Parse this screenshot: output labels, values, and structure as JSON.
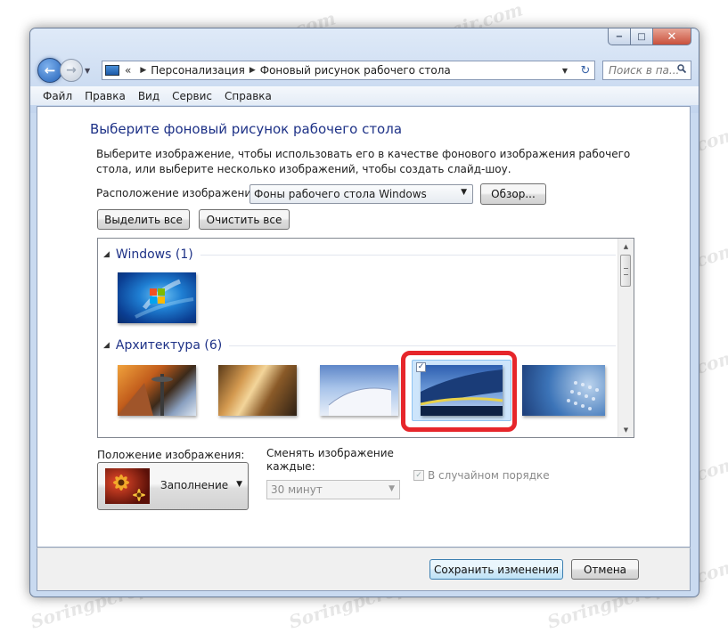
{
  "window": {
    "caption_buttons": {
      "minimize": "−",
      "maximize": "□",
      "close": "✕"
    }
  },
  "address_bar": {
    "separator": "«",
    "crumbs": [
      "Персонализация",
      "Фоновый рисунок рабочего стола"
    ],
    "search_placeholder": "Поиск в па..."
  },
  "menu": [
    "Файл",
    "Правка",
    "Вид",
    "Сервис",
    "Справка"
  ],
  "page": {
    "title": "Выберите фоновый рисунок рабочего стола",
    "description": "Выберите изображение, чтобы использовать его в качестве фонового изображения рабочего стола, или выберите несколько изображений, чтобы создать слайд-шоу.",
    "location_label": "Расположение изображения:",
    "location_value": "Фоны рабочего стола Windows",
    "browse_button": "Обзор...",
    "select_all_button": "Выделить все",
    "clear_all_button": "Очистить все"
  },
  "gallery": {
    "groups": [
      {
        "name": "Windows (1)",
        "count": 1
      },
      {
        "name": "Архитектура (6)",
        "count": 6
      }
    ],
    "selected_index": 3
  },
  "position": {
    "label": "Положение изображения:",
    "value": "Заполнение"
  },
  "slideshow": {
    "interval_label": "Сменять изображение каждые:",
    "interval_value": "30 минут",
    "shuffle_label": "В случайном порядке",
    "shuffle_checked": true
  },
  "footer": {
    "save_button": "Сохранить изменения",
    "cancel_button": "Отмена"
  },
  "watermark": "Soringpcrepair.com",
  "colors": {
    "heading": "#1e3287",
    "selection_highlight": "#e6262b",
    "selected_tile_bg": "#cde5fb"
  }
}
